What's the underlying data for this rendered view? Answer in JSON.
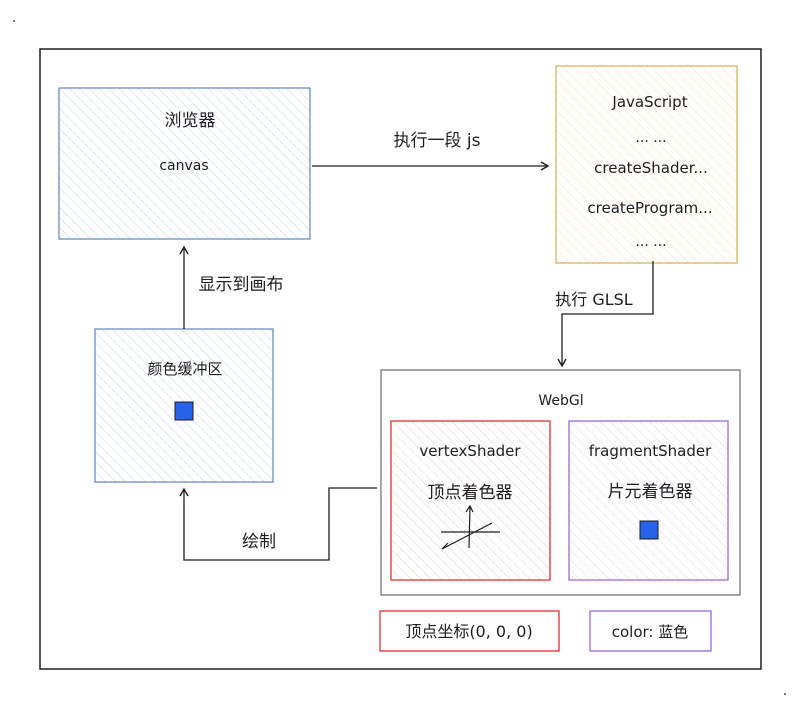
{
  "colors": {
    "stroke": "#1e1e1e",
    "blue_stroke": "#6c8ebf",
    "blue_fill": "#dae8fc",
    "yellow_stroke": "#d6b656",
    "yellow_fill": "#fff2cc",
    "red_stroke": "#e03131",
    "red_fill": "#ffe3e3",
    "purple_stroke": "#9c6ade",
    "purple_fill": "#f3e8ff",
    "square": "#2563eb"
  },
  "browser": {
    "title": "浏览器",
    "subtitle": "canvas"
  },
  "javascript": {
    "title": "JavaScript",
    "lines": [
      "... ...",
      "createShader...",
      "createProgram...",
      "... ..."
    ]
  },
  "framebuffer": {
    "title": "颜色缓冲区"
  },
  "webgl": {
    "title": "WebGl",
    "vertex": {
      "name": "vertexShader",
      "label": "顶点着色器"
    },
    "fragment": {
      "name": "fragmentShader",
      "label": "片元着色器"
    }
  },
  "arrows": {
    "run_js": "执行一段 js",
    "run_glsl": "执行 GLSL",
    "display": "显示到画布",
    "draw": "绘制"
  },
  "legend": {
    "vertex_coord": "顶点坐标(0, 0, 0)",
    "color": "color: 蓝色"
  }
}
